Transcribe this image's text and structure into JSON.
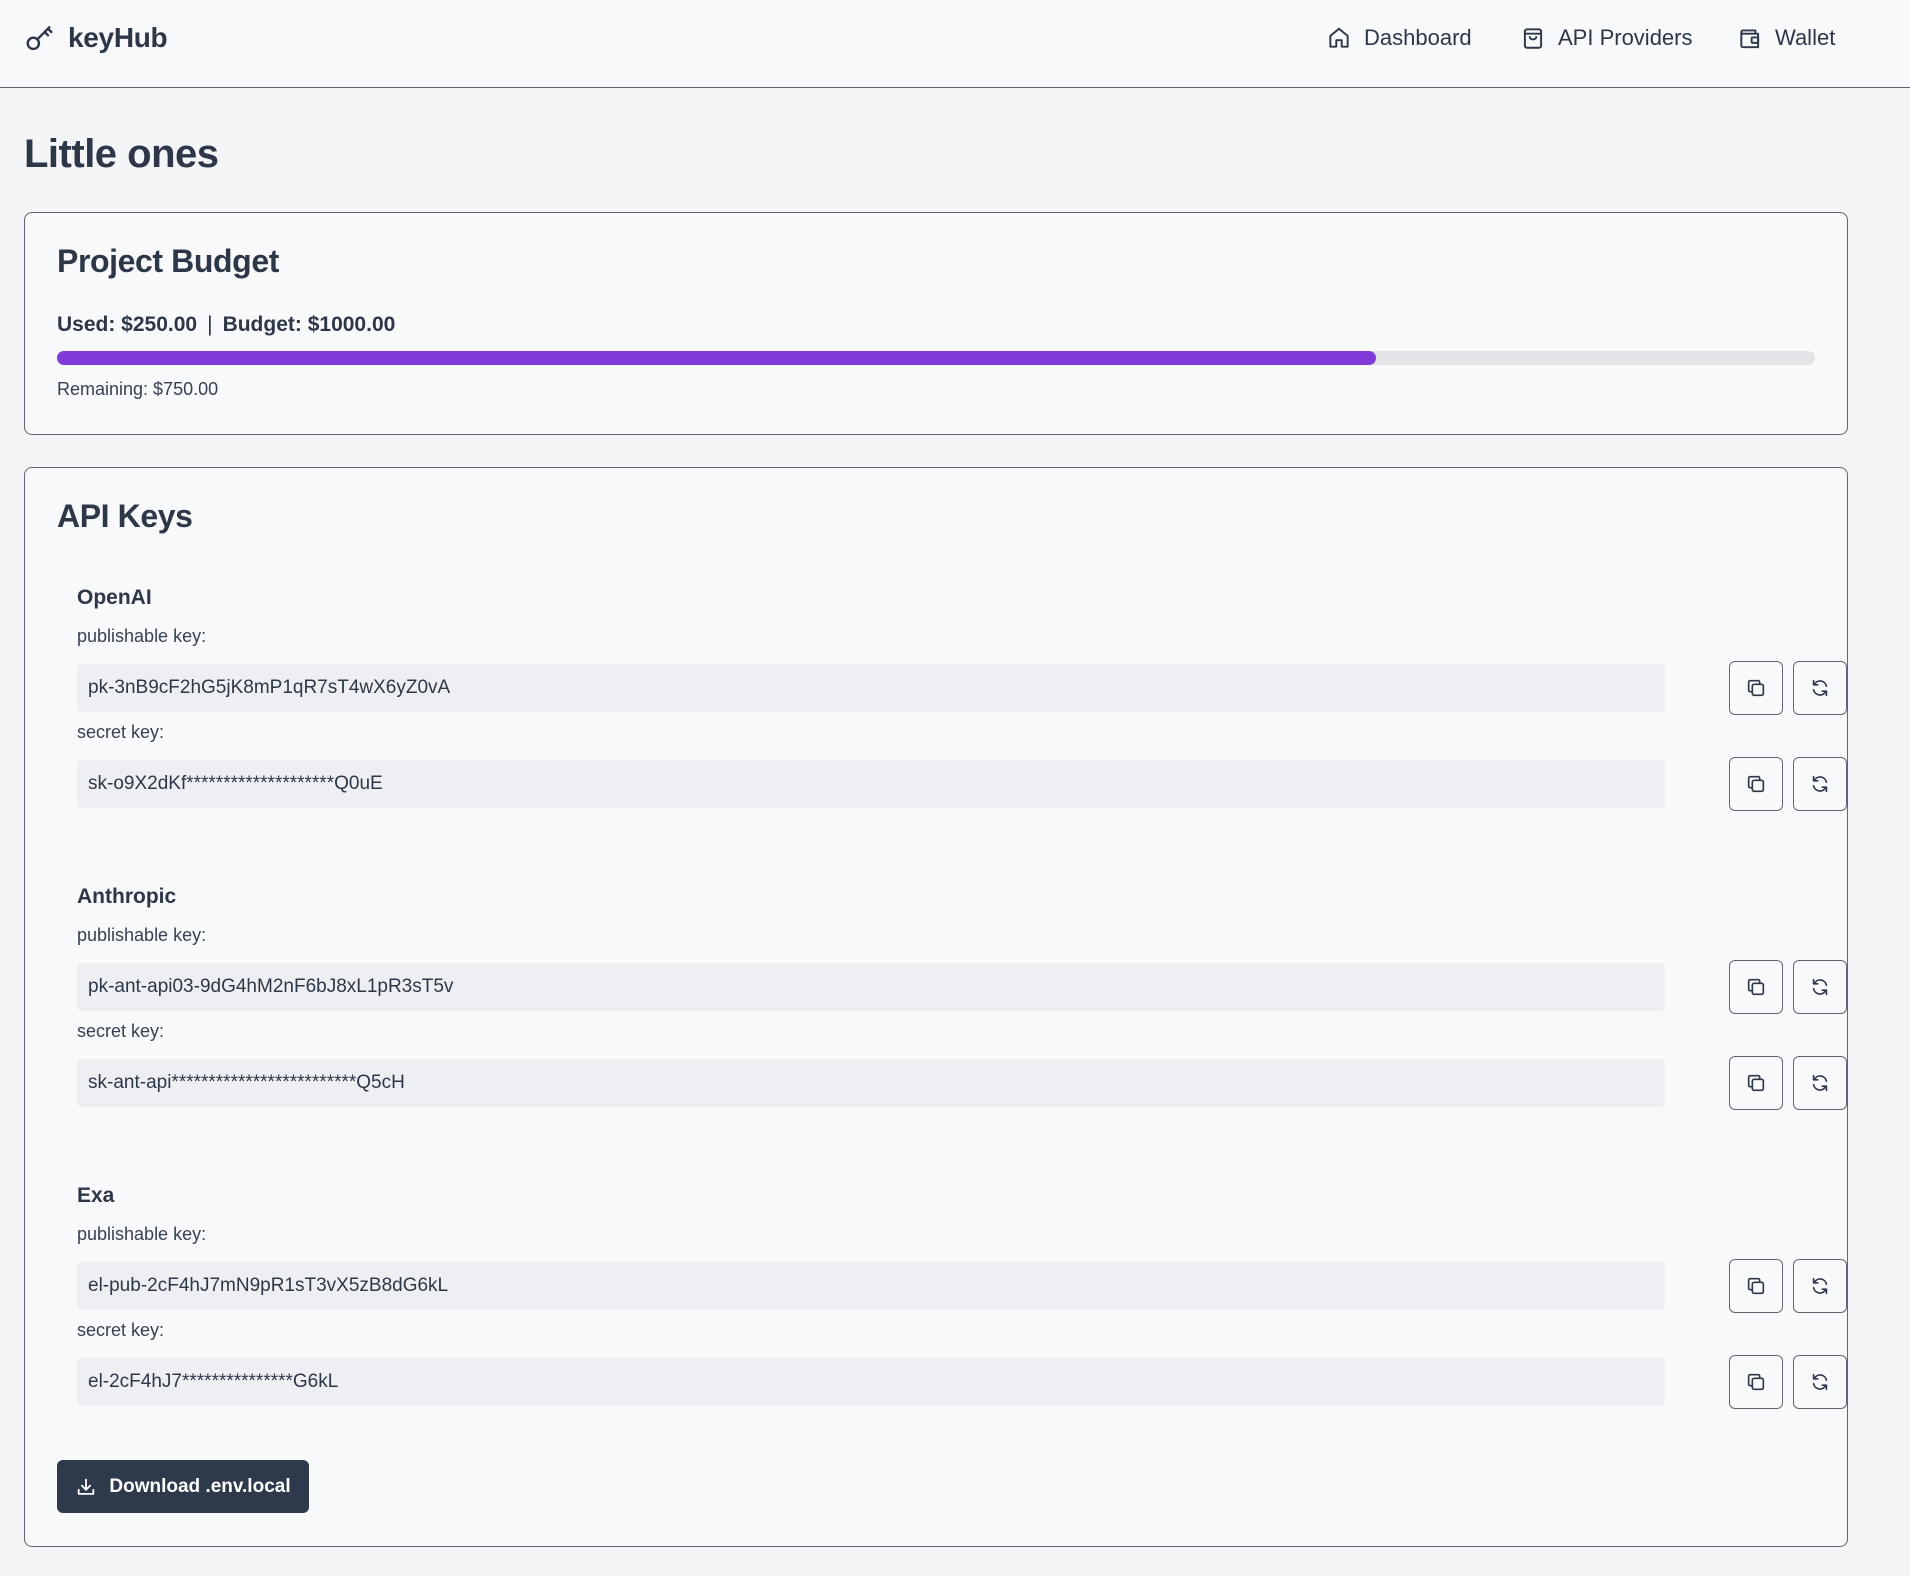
{
  "app": {
    "name": "keyHub"
  },
  "nav": {
    "dashboard": "Dashboard",
    "providers": "API Providers",
    "wallet": "Wallet"
  },
  "page": {
    "title": "Little ones"
  },
  "budget": {
    "title": "Project Budget",
    "used_label": "Used: $250.00",
    "separator": "|",
    "budget_label": "Budget: $1000.00",
    "remaining_label": "Remaining: $750.00",
    "progress_fraction": 0.75,
    "progress_color": "#7f3ad8"
  },
  "keys": {
    "title": "API Keys",
    "publishable_label": "publishable key:",
    "secret_label": "secret key:",
    "providers": [
      {
        "name": "OpenAI",
        "publishable": "pk-3nB9cF2hG5jK8mP1qR7sT4wX6yZ0vA",
        "secret": "sk-o9X2dKf********************Q0uE"
      },
      {
        "name": "Anthropic",
        "publishable": "pk-ant-api03-9dG4hM2nF6bJ8xL1pR3sT5v",
        "secret": "sk-ant-api*************************Q5cH"
      },
      {
        "name": "Exa",
        "publishable": "el-pub-2cF4hJ7mN9pR1sT3vX5zB8dG6kL",
        "secret": "el-2cF4hJ7***************G6kL"
      }
    ],
    "download_label": "Download .env.local"
  },
  "icons": {
    "brand": "key-icon",
    "dashboard": "home-icon",
    "providers": "shopping-bag-icon",
    "wallet": "wallet-icon",
    "copy": "copy-icon",
    "regenerate": "refresh-icon",
    "download": "download-icon"
  },
  "colors": {
    "accent": "#7f3ad8",
    "primary_button": "#2e3a4b",
    "text": "#2d3748"
  }
}
